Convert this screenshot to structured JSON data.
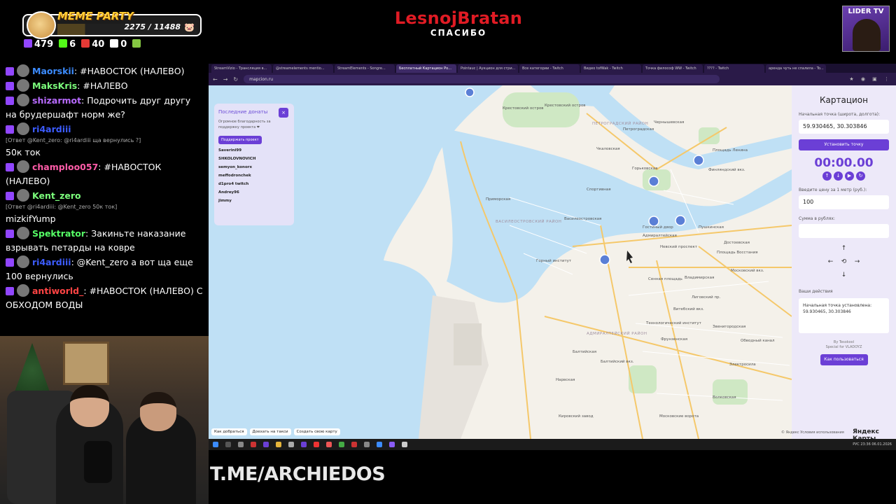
{
  "overlay": {
    "meme_party": {
      "label": "MEME PARTY",
      "counter": "2275 / 11488",
      "progress": 0.198
    },
    "stats": [
      {
        "icon": "twitch-icon",
        "value": "479",
        "color": "#9146ff"
      },
      {
        "icon": "kick-icon",
        "value": "6",
        "color": "#53fc18"
      },
      {
        "icon": "vk-icon",
        "value": "40",
        "color": "#e53935"
      },
      {
        "icon": "w-icon",
        "value": "0",
        "color": "#ffffff"
      },
      {
        "icon": "rumble-icon",
        "value": "",
        "color": "#85c742"
      }
    ],
    "brand": {
      "name": "LesnojBratan",
      "thanks": "СПАСИБО"
    },
    "lider": {
      "label": "LIDER TV"
    },
    "tme": "T.ME/ARCHIEDOS"
  },
  "chat": [
    {
      "user": "Maorskii",
      "color": "#3c8cff",
      "text": " #НАВОСТОК (НАЛЕВО)",
      "reply": ""
    },
    {
      "user": "MaksKris",
      "color": "#7cff7c",
      "text": " #НАЛЕВО",
      "reply": ""
    },
    {
      "user": "shizarmot",
      "color": "#b86bff",
      "text": " Подрочить друг другу на брудершафт норм же?",
      "reply": ""
    },
    {
      "user": "ri4ardiii",
      "color": "#3c5cff",
      "text": "",
      "reply": "[Ответ @Kent_zero: @ri4ardiii ща вернулись ?]"
    },
    {
      "user": "",
      "color": "#ffffff",
      "text": "50к ток",
      "reply": ""
    },
    {
      "user": "champloo057",
      "color": "#ff5ca8",
      "text": " #НАВОСТОК (НАЛЕВО)",
      "reply": ""
    },
    {
      "user": "Kent_zero",
      "color": "#7cff7c",
      "text": "",
      "reply": "[Ответ @ri4ardiii: @Kent_zero 50к ток]"
    },
    {
      "user": "",
      "color": "#ffffff",
      "text": "mizkifYump",
      "reply": ""
    },
    {
      "user": "Spektrator",
      "color": "#56ff66",
      "text": " Закиньте наказание взрывать петарды на ковре",
      "reply": ""
    },
    {
      "user": "ri4ardiii",
      "color": "#3c5cff",
      "text": " @Kent_zero а вот ща еще 100 вернулись",
      "reply": ""
    },
    {
      "user": "antiworld_",
      "color": "#ff4444",
      "text": " #НАВОСТОК (НАЛЕВО) С ОБХОДОМ ВОДЫ",
      "reply": ""
    }
  ],
  "browser": {
    "tabs": [
      "StreamVizio - Трансляция в...",
      "@streamelements mentio...",
      "StreamElements - Songre...",
      "Бесплатный Картацион Ро...",
      "Pointauc | Аукцион для стри...",
      "Все категории - Twitch",
      "Видео tofWak - Twitch",
      "Точка философ WW - Twitch",
      "???? - Twitch",
      "аренда чуть не спалила - To..."
    ],
    "url": "mapcion.ru"
  },
  "donations": {
    "title": "Последние донаты",
    "subtitle": "Огромное благодарность за поддержку проекта ❤",
    "button": "Поддержать проект",
    "names": [
      "Saverini99",
      "SHKOLOVNOVICH",
      "semyon_konorx",
      "meffodronchek",
      "d1pro4 twitch",
      "Andrey96",
      "jimmy"
    ]
  },
  "panel": {
    "title": "Картацион",
    "start_label": "Начальная точка (широта, долгота):",
    "start_value": "59.930465, 30.303846",
    "set_button": "Установить точку",
    "timer": "00:00.00",
    "price_label": "Введите цену за 1 метр (руб.):",
    "price_value": "100",
    "sum_label": "Сумма в рублях:",
    "sum_value": "",
    "actions_label": "Ваши действия",
    "actions_text": "Начальная точка установлена: 59.930465, 30.303846",
    "by": "By Tesokool",
    "special": "Special for VLADOYZ",
    "how_button": "Как пользоваться"
  },
  "map": {
    "controls": [
      "Как добраться",
      "Доехать на такси",
      "Создать свою карту"
    ],
    "attribution": "© Яндекс Условия использования",
    "logo": "Яндекс Карты",
    "labels": [
      {
        "text": "ПЕТРОГРАДСКИЙ РАЙОН",
        "cls": "dist"
      },
      {
        "text": "ВАСИЛЕОСТРОВСКИЙ РАЙОН",
        "cls": "dist"
      },
      {
        "text": "АДМИРАЛТЕЙСКИЙ РАЙОН",
        "cls": "dist"
      },
      {
        "text": "Крестовский остров",
        "cls": "lbl"
      },
      {
        "text": "Горьковская",
        "cls": "lbl"
      },
      {
        "text": "Петроградская",
        "cls": "lbl"
      },
      {
        "text": "Чкаловская",
        "cls": "lbl"
      },
      {
        "text": "Приморская",
        "cls": "lbl"
      },
      {
        "text": "Василеостровская",
        "cls": "lbl"
      },
      {
        "text": "Спортивная",
        "cls": "lbl"
      },
      {
        "text": "Адмиралтейская",
        "cls": "lbl"
      },
      {
        "text": "Невский проспект",
        "cls": "lbl"
      },
      {
        "text": "Горный институт",
        "cls": "lbl"
      },
      {
        "text": "Сенная площадь",
        "cls": "lbl"
      },
      {
        "text": "Технологический институт",
        "cls": "lbl"
      },
      {
        "text": "Балтийская",
        "cls": "lbl"
      },
      {
        "text": "Нарвская",
        "cls": "lbl"
      },
      {
        "text": "Фрунзенская",
        "cls": "lbl"
      },
      {
        "text": "Московские ворота",
        "cls": "lbl"
      },
      {
        "text": "Владимирская",
        "cls": "lbl"
      },
      {
        "text": "Площадь Восстания",
        "cls": "lbl"
      },
      {
        "text": "Московский вкз.",
        "cls": "lbl"
      },
      {
        "text": "Финляндский вкз.",
        "cls": "lbl"
      },
      {
        "text": "Витебский вкз.",
        "cls": "lbl"
      },
      {
        "text": "Балтийский вкз.",
        "cls": "lbl"
      },
      {
        "text": "Электросила",
        "cls": "lbl"
      },
      {
        "text": "Звенигородская",
        "cls": "lbl"
      },
      {
        "text": "Волковская",
        "cls": "lbl"
      },
      {
        "text": "Лиговский пр.",
        "cls": "lbl"
      },
      {
        "text": "Площадь Ленина",
        "cls": "lbl"
      },
      {
        "text": "Чернышевская",
        "cls": "lbl"
      },
      {
        "text": "Кировский завод",
        "cls": "lbl"
      },
      {
        "text": "Обводный канал",
        "cls": "lbl"
      },
      {
        "text": "Достоевская",
        "cls": "lbl"
      },
      {
        "text": "Гостиный двор",
        "cls": "lbl"
      },
      {
        "text": "Крестовский остров",
        "cls": "lbl"
      },
      {
        "text": "Пушкинская",
        "cls": "lbl"
      }
    ]
  },
  "taskbar": {
    "tray": "РУС 23:36 06.01.2026"
  }
}
